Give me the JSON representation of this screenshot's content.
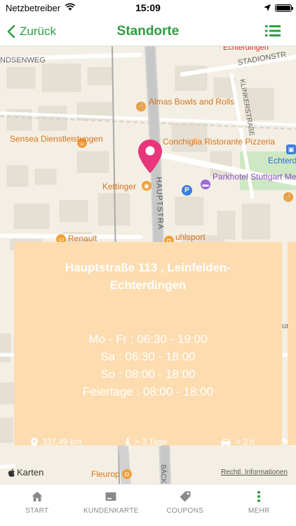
{
  "status_bar": {
    "carrier": "Netzbetreiber",
    "time": "15:09"
  },
  "nav": {
    "back_label": "Zurück",
    "title": "Standorte"
  },
  "map": {
    "street_labels": {
      "sandenweg": "NDSENWEG",
      "stadion": "STADIONSTR",
      "echterdingen_top": "Echterdingen",
      "klinker": "KLINKERSTRAßE",
      "haupt": "HAUPTSTRA",
      "echterd_right": "Echterd",
      "un": "un",
      "bach": "BÄCK"
    },
    "pois": {
      "almas": "Almas Bowls and Rolls",
      "sensea": "Sensea Dienstleistungen",
      "conchiglia": "Conchiglia Ristorante Pizzeria",
      "kettinger": "Kettinger",
      "parkhotel": "Parkhotel Stuttgart Messe-Airport",
      "renault": "Renault",
      "uhlsport": "uhlsport",
      "fleurop": "Fleurop"
    },
    "attribution_left": "Karten",
    "attribution_right": "Rechtl. Informationen"
  },
  "location_card": {
    "address": "Hauptstraße 113 , Leinfelden-Echterdingen",
    "hours": [
      "Mo - Fr : 06:30 - 19:00",
      "Sa : 06:30 - 18:00",
      "So : 08:00 - 18:00",
      "Feiertage : 08:00 - 18:00"
    ],
    "distance": "337,49 km",
    "walk_time": "> 3 Tage",
    "drive_time": "> 3 h"
  },
  "tabs": [
    {
      "label": "START",
      "icon": "home-icon"
    },
    {
      "label": "KUNDENKARTE",
      "icon": "card-icon"
    },
    {
      "label": "COUPONS",
      "icon": "tag-icon"
    },
    {
      "label": "MEHR",
      "icon": "more-icon"
    }
  ],
  "colors": {
    "brand_green": "#2f9e41",
    "pin": "#e8357b",
    "card": "#fddcb0"
  }
}
